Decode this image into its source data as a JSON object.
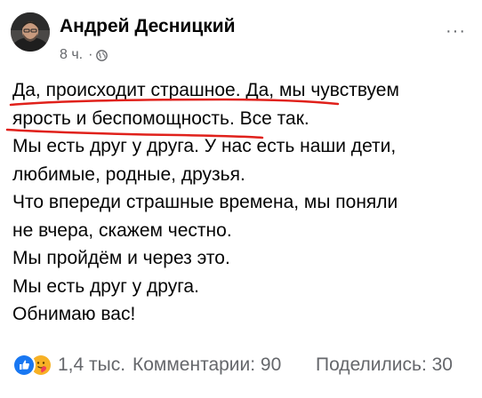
{
  "post": {
    "author": "Андрей Десницкий",
    "time": "8 ч.",
    "separator": "·",
    "audience_icon": "globe-icon",
    "more_icon": "ellipsis-icon",
    "more_label": "···",
    "lines": [
      "Да, происходит страшное. Да, мы чувствуем",
      "ярость и беспомощность. Все так.",
      "Мы есть друг у друга. У нас есть наши дети,",
      "любимые, родные, друзья.",
      "Что впереди страшные времена, мы поняли",
      "не вчера, скажем честно.",
      "Мы пройдём и через это.",
      "Мы есть друг у друга.",
      "Обнимаю вас!"
    ],
    "annotation_color": "#e0211b"
  },
  "footer": {
    "reaction_icons": [
      "like-icon",
      "care-icon"
    ],
    "reactions_count": "1,4 тыс.",
    "comments": "Комментарии: 90",
    "shares": "Поделились: 30"
  },
  "colors": {
    "text": "#050505",
    "secondary": "#65676b",
    "like_blue": "#1877f2",
    "care_yellow": "#f7b125",
    "annotation_red": "#e0211b"
  }
}
